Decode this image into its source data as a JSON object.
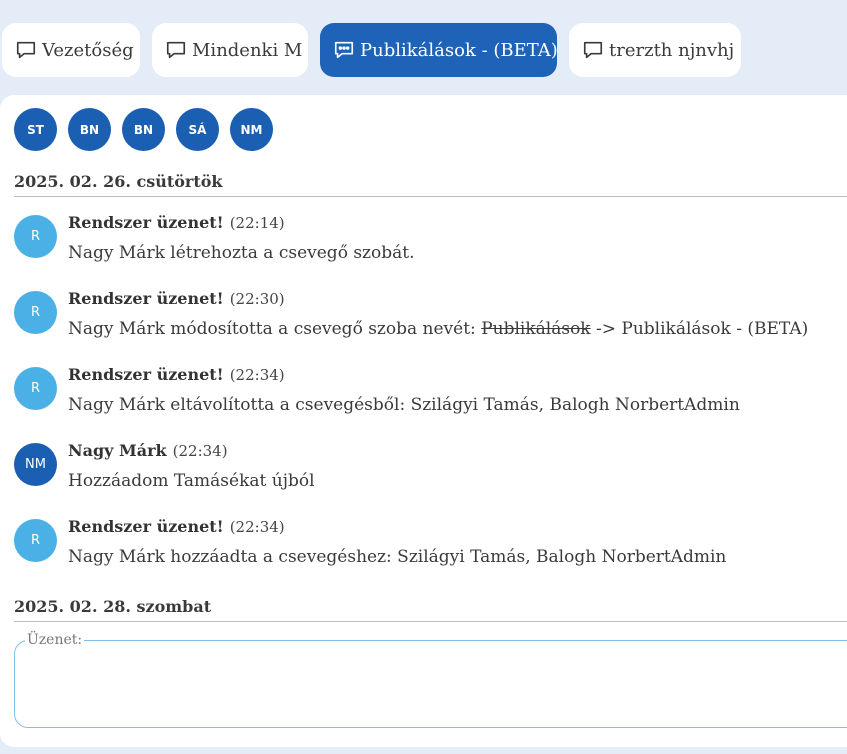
{
  "tabs": [
    {
      "label": "Vezetőség",
      "active": false,
      "icon": "chat-bubble-icon"
    },
    {
      "label": "Mindenki M",
      "active": false,
      "icon": "chat-bubble-icon"
    },
    {
      "label": "Publikálások - (BETA)",
      "active": true,
      "icon": "chat-bubble-dots-icon"
    },
    {
      "label": "trerzth njnvhj",
      "active": false,
      "icon": "chat-bubble-icon"
    }
  ],
  "participants": [
    "ST",
    "BN",
    "BN",
    "SÁ",
    "NM"
  ],
  "dates": [
    "2025. 02. 26. csütörtök",
    "2025. 02. 28. szombat"
  ],
  "messages": [
    {
      "avatar": "R",
      "sender": "Rendszer üzenet!",
      "time": "(22:14)",
      "text": "Nagy Márk létrehozta a csevegő szobát."
    },
    {
      "avatar": "R",
      "sender": "Rendszer üzenet!",
      "time": "(22:30)",
      "text_prefix": "Nagy Márk módosította a csevegő szoba nevét: ",
      "text_strike": "Publikálások",
      "text_suffix": " -> Publikálások - (BETA)"
    },
    {
      "avatar": "R",
      "sender": "Rendszer üzenet!",
      "time": "(22:34)",
      "text": "Nagy Márk eltávolította a csevegésből: Szilágyi Tamás, Balogh NorbertAdmin"
    },
    {
      "avatar": "NM",
      "sender": "Nagy Márk",
      "time": "(22:34)",
      "text": "Hozzáadom Tamásékat újból"
    },
    {
      "avatar": "R",
      "sender": "Rendszer üzenet!",
      "time": "(22:34)",
      "text": "Nagy Márk hozzáadta a csevegéshez: Szilágyi Tamás, Balogh NorbertAdmin"
    }
  ],
  "composer": {
    "label": "Üzenet:",
    "value": ""
  },
  "colors": {
    "accent": "#1e63b8",
    "system_avatar": "#4ab0e6",
    "user_avatar": "#1b5fb3",
    "background": "#e3ecf7"
  }
}
